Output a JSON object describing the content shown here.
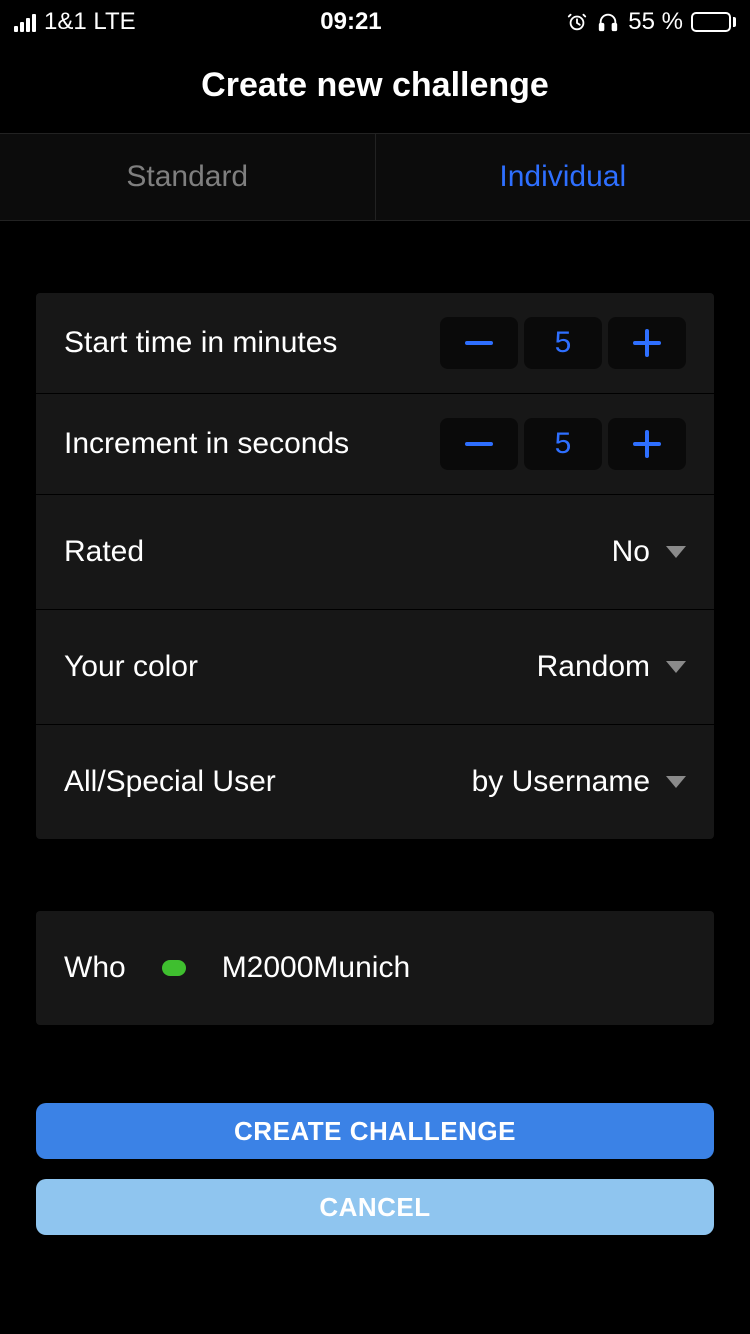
{
  "status": {
    "carrier": "1&1  LTE",
    "time": "09:21",
    "battery_pct": "55 %"
  },
  "header": {
    "title": "Create new challenge"
  },
  "tabs": {
    "standard": "Standard",
    "individual": "Individual"
  },
  "form": {
    "start_time": {
      "label": "Start time in minutes",
      "value": "5"
    },
    "increment": {
      "label": "Increment in seconds",
      "value": "5"
    },
    "rated": {
      "label": "Rated",
      "value": "No"
    },
    "color": {
      "label": "Your color",
      "value": "Random"
    },
    "user_mode": {
      "label": "All/Special User",
      "value": "by Username"
    }
  },
  "who": {
    "label": "Who",
    "username": "M2000Munich"
  },
  "buttons": {
    "create": "CREATE CHALLENGE",
    "cancel": "CANCEL"
  }
}
